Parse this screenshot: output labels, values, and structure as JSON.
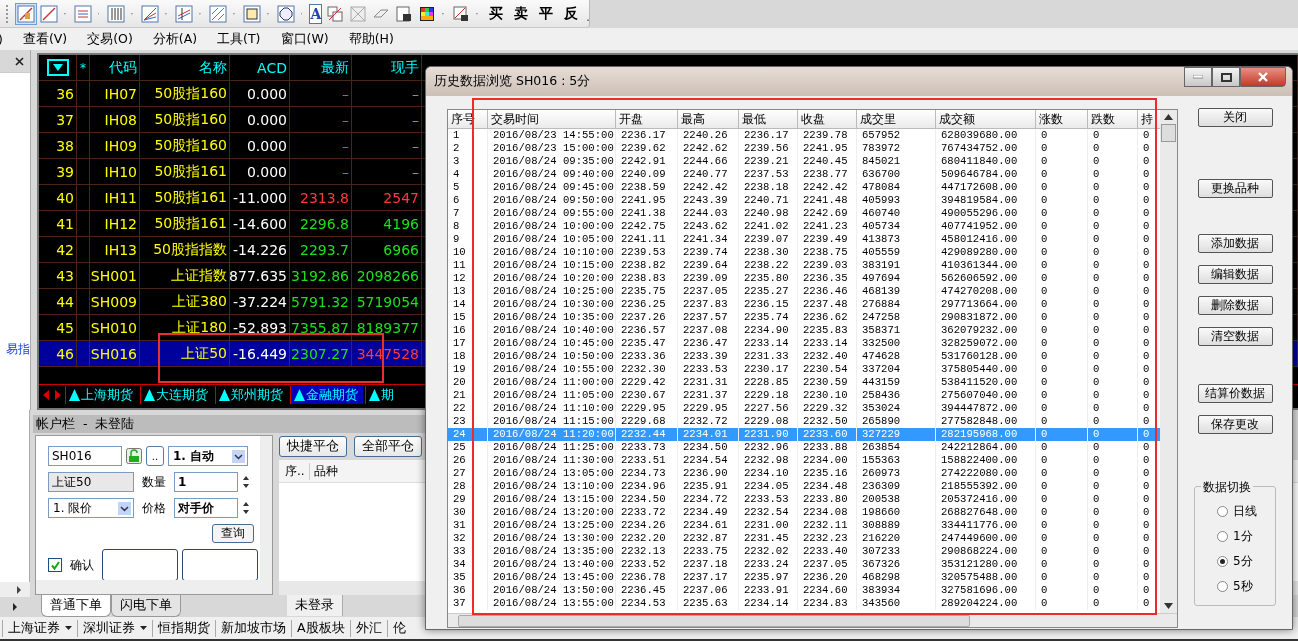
{
  "toolbar": {
    "text_tool": "A",
    "trade_buttons": [
      "买",
      "卖",
      "平",
      "反"
    ]
  },
  "menu": [
    ")",
    "查看(V)",
    "交易(O)",
    "分析(A)",
    "工具(T)",
    "窗口(W)",
    "帮助(H)"
  ],
  "left_pane": {
    "link": "易指"
  },
  "quote_table": {
    "star": "*",
    "columns": [
      "代码",
      "名称",
      "ACD",
      "最新",
      "现手"
    ],
    "rows": [
      {
        "no": "36",
        "code": "IH07",
        "name": "50股指160",
        "acd": "0.000",
        "last": "–",
        "last_up": true,
        "vol": "–",
        "vol_up": false,
        "selected": false
      },
      {
        "no": "37",
        "code": "IH08",
        "name": "50股指160",
        "acd": "0.000",
        "last": "–",
        "last_up": true,
        "vol": "–",
        "vol_up": false,
        "selected": false
      },
      {
        "no": "38",
        "code": "IH09",
        "name": "50股指160",
        "acd": "0.000",
        "last": "–",
        "last_up": true,
        "vol": "–",
        "vol_up": false,
        "selected": false
      },
      {
        "no": "39",
        "code": "IH10",
        "name": "50股指161",
        "acd": "0.000",
        "last": "–",
        "last_up": true,
        "vol": "–",
        "vol_up": false,
        "selected": false
      },
      {
        "no": "40",
        "code": "IH11",
        "name": "50股指161",
        "acd": "-11.000",
        "last": "2313.8",
        "last_up": true,
        "vol": "2547",
        "vol_up": true,
        "selected": false
      },
      {
        "no": "41",
        "code": "IH12",
        "name": "50股指161",
        "acd": "-14.600",
        "last": "2296.8",
        "last_up": false,
        "vol": "4196",
        "vol_up": false,
        "selected": false
      },
      {
        "no": "42",
        "code": "IH13",
        "name": "50股指指数",
        "acd": "-14.226",
        "last": "2293.7",
        "last_up": false,
        "vol": "6966",
        "vol_up": false,
        "selected": false
      },
      {
        "no": "43",
        "code": "SH001",
        "name": "上证指数",
        "acd": "877.635",
        "last": "3192.86",
        "last_up": false,
        "vol": "2098266",
        "vol_up": false,
        "selected": false
      },
      {
        "no": "44",
        "code": "SH009",
        "name": "上证380",
        "acd": "-37.224",
        "last": "5791.32",
        "last_up": false,
        "vol": "5719054",
        "vol_up": false,
        "selected": false
      },
      {
        "no": "45",
        "code": "SH010",
        "name": "上证180",
        "acd": "-52.893",
        "last": "7355.87",
        "last_up": false,
        "vol": "8189377",
        "vol_up": false,
        "selected": false
      },
      {
        "no": "46",
        "code": "SH016",
        "name": "上证50",
        "acd": "-16.449",
        "last": "2307.27",
        "last_up": false,
        "vol": "3447528",
        "vol_up": true,
        "selected": true
      }
    ]
  },
  "market_tabs": [
    {
      "label": "上海期货",
      "selected": false
    },
    {
      "label": "大连期货",
      "selected": false
    },
    {
      "label": "郑州期货",
      "selected": false
    },
    {
      "label": "金融期货",
      "selected": true
    },
    {
      "label": "期",
      "selected": false
    }
  ],
  "account_bar": {
    "title": "帐户栏  -  未登陆"
  },
  "order_form": {
    "code": "SH016",
    "more": "..",
    "mode": "1. 自动",
    "name": "上证50",
    "qty_label": "数量",
    "qty": "1",
    "price_type": "1. 限价",
    "price_label": "价格",
    "price": "对手价",
    "query": "查询",
    "confirm": {
      "label": "确认",
      "checked": true
    }
  },
  "positions": {
    "buttons": [
      "快捷平仓",
      "全部平仓"
    ],
    "columns": [
      "序..",
      "品种"
    ],
    "status_tab": "未登录"
  },
  "order_tabs": [
    {
      "label": "普通下单",
      "selected": true
    },
    {
      "label": "闪电下单",
      "selected": false
    }
  ],
  "status_bar": [
    {
      "label": "上海证券",
      "dropdown": true
    },
    {
      "label": "深圳证券",
      "dropdown": true
    },
    {
      "label": "恒指期货",
      "dropdown": false
    },
    {
      "label": "新加坡市场",
      "dropdown": false
    },
    {
      "label": "A股板块",
      "dropdown": false
    },
    {
      "label": "外汇",
      "dropdown": false
    },
    {
      "label": "伦",
      "dropdown": false
    }
  ],
  "dialog": {
    "title": "历史数据浏览 SH016 : 5分",
    "columns": [
      "序号",
      "交易时间",
      "开盘",
      "最高",
      "最低",
      "收盘",
      "成交里",
      "成交额",
      "涨数",
      "跌数",
      "持"
    ],
    "rows": [
      {
        "cells": [
          "1",
          "2016/08/23 14:55:00",
          "2236.17",
          "2240.26",
          "2236.17",
          "2239.78",
          "657952",
          "628039680.00",
          "0",
          "0",
          "0"
        ],
        "selected": false
      },
      {
        "cells": [
          "2",
          "2016/08/23 15:00:00",
          "2239.62",
          "2242.62",
          "2239.56",
          "2241.95",
          "783972",
          "767434752.00",
          "0",
          "0",
          "0"
        ],
        "selected": false
      },
      {
        "cells": [
          "3",
          "2016/08/24 09:35:00",
          "2242.91",
          "2244.66",
          "2239.21",
          "2240.45",
          "845021",
          "680411840.00",
          "0",
          "0",
          "0"
        ],
        "selected": false
      },
      {
        "cells": [
          "4",
          "2016/08/24 09:40:00",
          "2240.09",
          "2240.77",
          "2237.53",
          "2238.77",
          "636700",
          "509646784.00",
          "0",
          "0",
          "0"
        ],
        "selected": false
      },
      {
        "cells": [
          "5",
          "2016/08/24 09:45:00",
          "2238.59",
          "2242.42",
          "2238.18",
          "2242.42",
          "478084",
          "447172608.00",
          "0",
          "0",
          "0"
        ],
        "selected": false
      },
      {
        "cells": [
          "6",
          "2016/08/24 09:50:00",
          "2241.95",
          "2243.39",
          "2240.71",
          "2241.48",
          "405993",
          "394819584.00",
          "0",
          "0",
          "0"
        ],
        "selected": false
      },
      {
        "cells": [
          "7",
          "2016/08/24 09:55:00",
          "2241.38",
          "2244.03",
          "2240.98",
          "2242.69",
          "460740",
          "490055296.00",
          "0",
          "0",
          "0"
        ],
        "selected": false
      },
      {
        "cells": [
          "8",
          "2016/08/24 10:00:00",
          "2242.75",
          "2243.62",
          "2241.02",
          "2241.23",
          "405734",
          "407741952.00",
          "0",
          "0",
          "0"
        ],
        "selected": false
      },
      {
        "cells": [
          "9",
          "2016/08/24 10:05:00",
          "2241.11",
          "2241.34",
          "2239.07",
          "2239.49",
          "413873",
          "458012416.00",
          "0",
          "0",
          "0"
        ],
        "selected": false
      },
      {
        "cells": [
          "10",
          "2016/08/24 10:10:00",
          "2239.53",
          "2239.74",
          "2238.30",
          "2238.75",
          "405559",
          "429089280.00",
          "0",
          "0",
          "0"
        ],
        "selected": false
      },
      {
        "cells": [
          "11",
          "2016/08/24 10:15:00",
          "2238.82",
          "2239.64",
          "2238.22",
          "2239.03",
          "383191",
          "410361344.00",
          "0",
          "0",
          "0"
        ],
        "selected": false
      },
      {
        "cells": [
          "12",
          "2016/08/24 10:20:00",
          "2238.83",
          "2239.09",
          "2235.80",
          "2236.35",
          "497694",
          "562606592.00",
          "0",
          "0",
          "0"
        ],
        "selected": false
      },
      {
        "cells": [
          "13",
          "2016/08/24 10:25:00",
          "2235.75",
          "2237.05",
          "2235.27",
          "2236.46",
          "468139",
          "474270208.00",
          "0",
          "0",
          "0"
        ],
        "selected": false
      },
      {
        "cells": [
          "14",
          "2016/08/24 10:30:00",
          "2236.25",
          "2237.83",
          "2236.15",
          "2237.48",
          "276884",
          "297713664.00",
          "0",
          "0",
          "0"
        ],
        "selected": false
      },
      {
        "cells": [
          "15",
          "2016/08/24 10:35:00",
          "2237.26",
          "2237.57",
          "2235.74",
          "2236.62",
          "247258",
          "290831872.00",
          "0",
          "0",
          "0"
        ],
        "selected": false
      },
      {
        "cells": [
          "16",
          "2016/08/24 10:40:00",
          "2236.57",
          "2237.08",
          "2234.90",
          "2235.83",
          "358371",
          "362079232.00",
          "0",
          "0",
          "0"
        ],
        "selected": false
      },
      {
        "cells": [
          "17",
          "2016/08/24 10:45:00",
          "2235.47",
          "2236.47",
          "2233.14",
          "2233.14",
          "332500",
          "328259072.00",
          "0",
          "0",
          "0"
        ],
        "selected": false
      },
      {
        "cells": [
          "18",
          "2016/08/24 10:50:00",
          "2233.36",
          "2233.39",
          "2231.33",
          "2232.40",
          "474628",
          "531760128.00",
          "0",
          "0",
          "0"
        ],
        "selected": false
      },
      {
        "cells": [
          "19",
          "2016/08/24 10:55:00",
          "2232.30",
          "2233.53",
          "2230.17",
          "2230.54",
          "337204",
          "375805440.00",
          "0",
          "0",
          "0"
        ],
        "selected": false
      },
      {
        "cells": [
          "20",
          "2016/08/24 11:00:00",
          "2229.42",
          "2231.31",
          "2228.85",
          "2230.59",
          "443159",
          "538411520.00",
          "0",
          "0",
          "0"
        ],
        "selected": false
      },
      {
        "cells": [
          "21",
          "2016/08/24 11:05:00",
          "2230.67",
          "2231.37",
          "2229.18",
          "2230.10",
          "258436",
          "275607040.00",
          "0",
          "0",
          "0"
        ],
        "selected": false
      },
      {
        "cells": [
          "22",
          "2016/08/24 11:10:00",
          "2229.95",
          "2229.95",
          "2227.56",
          "2229.32",
          "353024",
          "394447872.00",
          "0",
          "0",
          "0"
        ],
        "selected": false
      },
      {
        "cells": [
          "23",
          "2016/08/24 11:15:00",
          "2229.68",
          "2232.72",
          "2229.08",
          "2232.50",
          "265890",
          "277582848.00",
          "0",
          "0",
          "0"
        ],
        "selected": false
      },
      {
        "cells": [
          "24",
          "2016/08/24 11:20:00",
          "2232.44",
          "2234.01",
          "2231.90",
          "2233.60",
          "327229",
          "282195968.00",
          "0",
          "0",
          "0"
        ],
        "selected": true
      },
      {
        "cells": [
          "25",
          "2016/08/24 11:25:00",
          "2233.73",
          "2234.50",
          "2232.96",
          "2233.88",
          "263854",
          "242212864.00",
          "0",
          "0",
          "0"
        ],
        "selected": false
      },
      {
        "cells": [
          "26",
          "2016/08/24 11:30:00",
          "2233.51",
          "2234.54",
          "2232.98",
          "2234.00",
          "155363",
          "158822400.00",
          "0",
          "0",
          "0"
        ],
        "selected": false
      },
      {
        "cells": [
          "27",
          "2016/08/24 13:05:00",
          "2234.73",
          "2236.90",
          "2234.10",
          "2235.16",
          "260973",
          "274222080.00",
          "0",
          "0",
          "0"
        ],
        "selected": false
      },
      {
        "cells": [
          "28",
          "2016/08/24 13:10:00",
          "2234.96",
          "2235.91",
          "2234.05",
          "2234.48",
          "236309",
          "218555392.00",
          "0",
          "0",
          "0"
        ],
        "selected": false
      },
      {
        "cells": [
          "29",
          "2016/08/24 13:15:00",
          "2234.50",
          "2234.72",
          "2233.53",
          "2233.80",
          "200538",
          "205372416.00",
          "0",
          "0",
          "0"
        ],
        "selected": false
      },
      {
        "cells": [
          "30",
          "2016/08/24 13:20:00",
          "2233.72",
          "2234.49",
          "2232.54",
          "2234.08",
          "198660",
          "268827648.00",
          "0",
          "0",
          "0"
        ],
        "selected": false
      },
      {
        "cells": [
          "31",
          "2016/08/24 13:25:00",
          "2234.26",
          "2234.61",
          "2231.00",
          "2232.11",
          "308889",
          "334411776.00",
          "0",
          "0",
          "0"
        ],
        "selected": false
      },
      {
        "cells": [
          "32",
          "2016/08/24 13:30:00",
          "2232.20",
          "2232.87",
          "2231.45",
          "2232.23",
          "216220",
          "247449600.00",
          "0",
          "0",
          "0"
        ],
        "selected": false
      },
      {
        "cells": [
          "33",
          "2016/08/24 13:35:00",
          "2232.13",
          "2233.75",
          "2232.02",
          "2233.40",
          "307233",
          "290868224.00",
          "0",
          "0",
          "0"
        ],
        "selected": false
      },
      {
        "cells": [
          "34",
          "2016/08/24 13:40:00",
          "2233.52",
          "2237.18",
          "2233.24",
          "2237.05",
          "367326",
          "353121280.00",
          "0",
          "0",
          "0"
        ],
        "selected": false
      },
      {
        "cells": [
          "35",
          "2016/08/24 13:45:00",
          "2236.78",
          "2237.17",
          "2235.97",
          "2236.20",
          "468298",
          "320575488.00",
          "0",
          "0",
          "0"
        ],
        "selected": false
      },
      {
        "cells": [
          "36",
          "2016/08/24 13:50:00",
          "2236.45",
          "2237.06",
          "2233.91",
          "2234.60",
          "383934",
          "327581696.00",
          "0",
          "0",
          "0"
        ],
        "selected": false
      },
      {
        "cells": [
          "37",
          "2016/08/24 13:55:00",
          "2234.53",
          "2235.63",
          "2234.14",
          "2234.83",
          "343560",
          "289204224.00",
          "0",
          "0",
          "0"
        ],
        "selected": false
      }
    ],
    "button_groups": [
      [
        "关闭"
      ],
      [
        "更换品种"
      ],
      [
        "添加数据",
        "编辑数据",
        "删除数据",
        "清空数据"
      ],
      [
        "结算价数据",
        "保存更改"
      ]
    ],
    "switch": {
      "title": "数据切换",
      "options": [
        {
          "label": "日线",
          "selected": false
        },
        {
          "label": "1分",
          "selected": false
        },
        {
          "label": "5分",
          "selected": true
        },
        {
          "label": "5秒",
          "selected": false
        }
      ]
    }
  }
}
